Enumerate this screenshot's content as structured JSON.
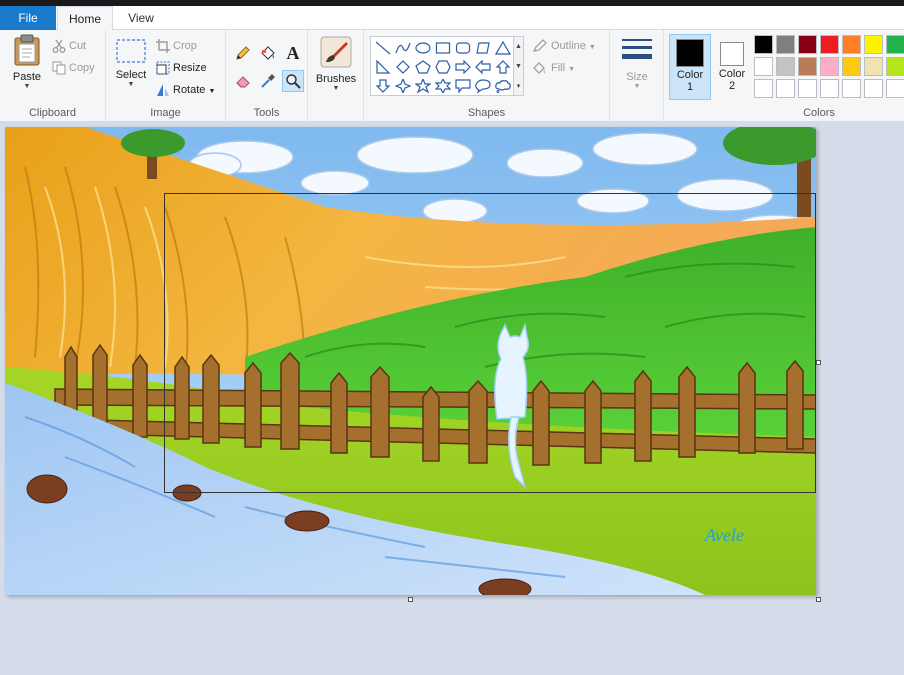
{
  "tabs": {
    "file": "File",
    "home": "Home",
    "view": "View"
  },
  "clipboard": {
    "group_label": "Clipboard",
    "paste": "Paste",
    "cut": "Cut",
    "copy": "Copy"
  },
  "image": {
    "group_label": "Image",
    "select": "Select",
    "crop": "Crop",
    "resize": "Resize",
    "rotate": "Rotate"
  },
  "tools": {
    "group_label": "Tools",
    "active_tool": "magnifier"
  },
  "brushes": {
    "label": "Brushes"
  },
  "shapes": {
    "group_label": "Shapes",
    "outline": "Outline",
    "fill": "Fill"
  },
  "size": {
    "label": "Size"
  },
  "colors": {
    "group_label": "Colors",
    "color1_label": "Color\n1",
    "color2_label": "Color\n2",
    "color1": "#000000",
    "color2": "#ffffff",
    "palette_row1": [
      "#000000",
      "#7f7f7f",
      "#880015",
      "#ed1c24",
      "#ff7f27",
      "#fff200",
      "#22b14c"
    ],
    "palette_row2": [
      "#ffffff",
      "#c3c3c3",
      "#b97a57",
      "#ffaec9",
      "#ffc90e",
      "#efe4b0",
      "#b5e61d"
    ],
    "palette_row3": [
      "#ffffff",
      "#ffffff",
      "#ffffff",
      "#ffffff",
      "#ffffff",
      "#ffffff",
      "#ffffff"
    ]
  },
  "canvas": {
    "signature": "Avele"
  }
}
